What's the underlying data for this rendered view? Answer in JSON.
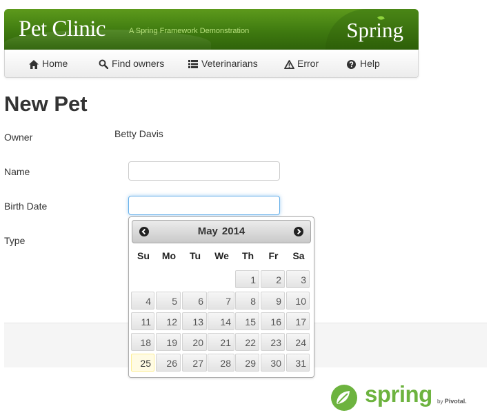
{
  "header": {
    "title": "Pet Clinic",
    "tagline": "A Spring Framework Demonstration",
    "brand": "Spring"
  },
  "nav": {
    "items": [
      {
        "label": "Home",
        "icon": "home-icon"
      },
      {
        "label": "Find owners",
        "icon": "search-icon"
      },
      {
        "label": "Veterinarians",
        "icon": "list-icon"
      },
      {
        "label": "Error",
        "icon": "warning-icon"
      },
      {
        "label": "Help",
        "icon": "question-circle-icon"
      }
    ]
  },
  "form": {
    "heading": "New Pet",
    "owner_label": "Owner",
    "owner_value": "Betty Davis",
    "name_label": "Name",
    "name_value": "",
    "birthdate_label": "Birth Date",
    "birthdate_value": "",
    "type_label": "Type"
  },
  "datepicker": {
    "month": "May",
    "year": "2014",
    "weekdays": [
      "Su",
      "Mo",
      "Tu",
      "We",
      "Th",
      "Fr",
      "Sa"
    ],
    "first_weekday_index": 4,
    "days_in_month": 31,
    "highlighted_day": 25
  },
  "footer": {
    "logo_word": "spring",
    "by_label": "by",
    "company": "Pivotal."
  },
  "colors": {
    "brand_green": "#6db33f",
    "header_green": "#3f7a10",
    "focus_blue": "#66afe9",
    "today_bg": "#fffbe3"
  }
}
